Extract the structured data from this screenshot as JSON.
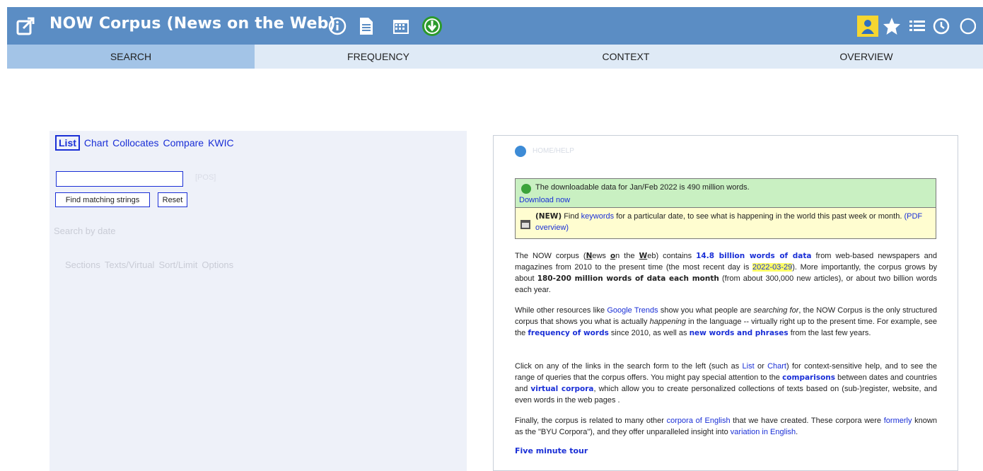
{
  "app": {
    "title": "NOW Corpus (News on the Web)"
  },
  "header_icons": [
    {
      "name": "info-icon"
    },
    {
      "name": "document-icon"
    },
    {
      "name": "calendar-icon"
    },
    {
      "name": "download-icon"
    }
  ],
  "right_icons": [
    {
      "name": "user-icon"
    },
    {
      "name": "star-icon"
    },
    {
      "name": "list-icon"
    },
    {
      "name": "history-icon"
    }
  ],
  "tabs": [
    {
      "label": "SEARCH"
    },
    {
      "label": "FREQUENCY"
    },
    {
      "label": "CONTEXT"
    },
    {
      "label": "OVERVIEW"
    }
  ],
  "search": {
    "modes": [
      "List",
      "Chart",
      "Collocates",
      "Compare",
      "KWIC"
    ],
    "active_mode": "List",
    "input_value": "",
    "pos_hint": "[POS]",
    "find_label": "Find matching strings",
    "reset_label": "Reset",
    "by_date": "Search by date",
    "options": [
      "Sections",
      "Texts/Virtual",
      "Sort/Limit",
      "Options"
    ]
  },
  "info": {
    "home_label": "HOME/HELP",
    "green_notice": "The downloadable data for Jan/Feb 2022 is 490 million words.",
    "green_link": "Download now",
    "yellow_new": "(NEW)",
    "yellow_find": "Find",
    "yellow_keywords": "keywords",
    "yellow_rest": "for a particular date, to see what is happening in the world this past week or month.",
    "yellow_pdf": "(PDF overview)",
    "p1": {
      "a": "The NOW corpus (",
      "n": "N",
      "ews": "ews ",
      "o": "o",
      "n2": "n the ",
      "w": "W",
      "eb": "eb) contains ",
      "bold1": "14.8 billion words of data",
      "b": " from web-based newspapers and magazines from 2010 to the present time (the most recent day is ",
      "date": "2022-03-29",
      "c": "). More importantly, the corpus grows by about ",
      "bold2": "180-200 million words of data each month",
      "d": " (from about 300,000 new articles), or about two billion words each year."
    },
    "p2": {
      "a": "While other resources like ",
      "link1": "Google Trends",
      "b": " show you what people are ",
      "i1": "searching for",
      "c": ", the NOW Corpus is the only structured corpus that shows you what is actually ",
      "i2": "happening",
      "d": " in the language -- virtually right up to the present time. For example, see the ",
      "link2": "frequency of words",
      "e": " since 2010, as well as ",
      "link3": "new words and phrases",
      "f": " from the last few years."
    },
    "p3": {
      "a": "Click on any of the links in the search form to the left (such as ",
      "link1": "List",
      "or": " or ",
      "link2": "Chart",
      "b": ") for context-sensitive help, and to see the range of queries that the corpus offers. You might pay special attention to the ",
      "link3": "comparisons",
      "c": " between dates and countries and ",
      "link4": "virtual corpora",
      "d": ", which allow you to create personalized collections of texts based on (sub-)register, website, and even words in the web pages ."
    },
    "p4": {
      "a": "Finally, the corpus is related to many other ",
      "link1": "corpora of English",
      "b": " that we have created. These corpora were ",
      "link2": "formerly",
      "c": " known as the \"BYU Corpora\"), and they offer unparalleled insight into ",
      "link3": "variation in English",
      "d": "."
    },
    "tour": "Five minute tour"
  },
  "colors": {
    "header": "#5b8dc4",
    "tabbar": "#a9c8e8",
    "link": "#1a2fd6",
    "green_notice": "#c9f0c2",
    "yellow_notice": "#fffdd0"
  }
}
